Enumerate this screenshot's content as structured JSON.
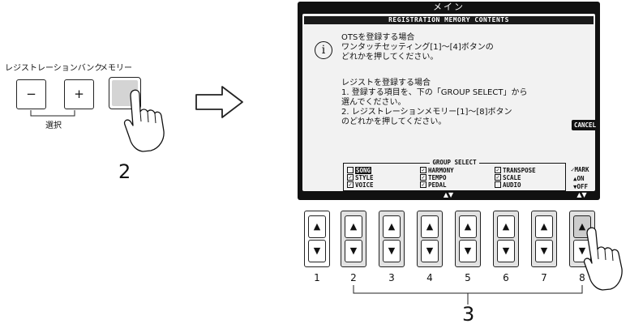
{
  "left_panel": {
    "bank_label": "レジストレーションバンク",
    "memory_label": "メモリー",
    "minus_label": "−",
    "plus_label": "+",
    "select_label": "選択",
    "step_label": "2"
  },
  "arrow_icon": "right-outline-arrow-icon",
  "screen": {
    "title": "メイン",
    "header": "REGISTRATION MEMORY CONTENTS",
    "info_icon": "info-icon",
    "ots_lines": [
      "OTSを登録する場合",
      "ワンタッチセッティング[1]〜[4]ボタンの",
      "どれかを押してください。"
    ],
    "reg_lines": [
      "レジストを登録する場合",
      "1. 登録する項目を、下の「GROUP SELECT」から",
      "    選んでください。",
      "2. レジストレーションメモリー[1]〜[8]ボタン",
      "    のどれかを押してください。"
    ],
    "cancel_label": "CANCEL",
    "group_select": {
      "title": "GROUP SELECT",
      "items": [
        {
          "label": "SONG",
          "checked": false,
          "selected": true
        },
        {
          "label": "STYLE",
          "checked": true
        },
        {
          "label": "VOICE",
          "checked": true
        },
        {
          "label": "HARMONY",
          "checked": true
        },
        {
          "label": "TEMPO",
          "checked": true
        },
        {
          "label": "PEDAL",
          "checked": true
        },
        {
          "label": "TRANSPOSE",
          "checked": true
        },
        {
          "label": "SCALE",
          "checked": true
        },
        {
          "label": "AUDIO",
          "checked": false
        }
      ]
    },
    "legend": {
      "mark": "✓MARK",
      "on": "▲ON",
      "off": "▼OFF"
    },
    "bottom_center": "▲▼",
    "bottom_right": "▲▼"
  },
  "hardware_buttons": {
    "labels": [
      "1",
      "2",
      "3",
      "4",
      "5",
      "6",
      "7",
      "8"
    ],
    "up": "▲",
    "down": "▼"
  },
  "step_bottom_label": "3"
}
